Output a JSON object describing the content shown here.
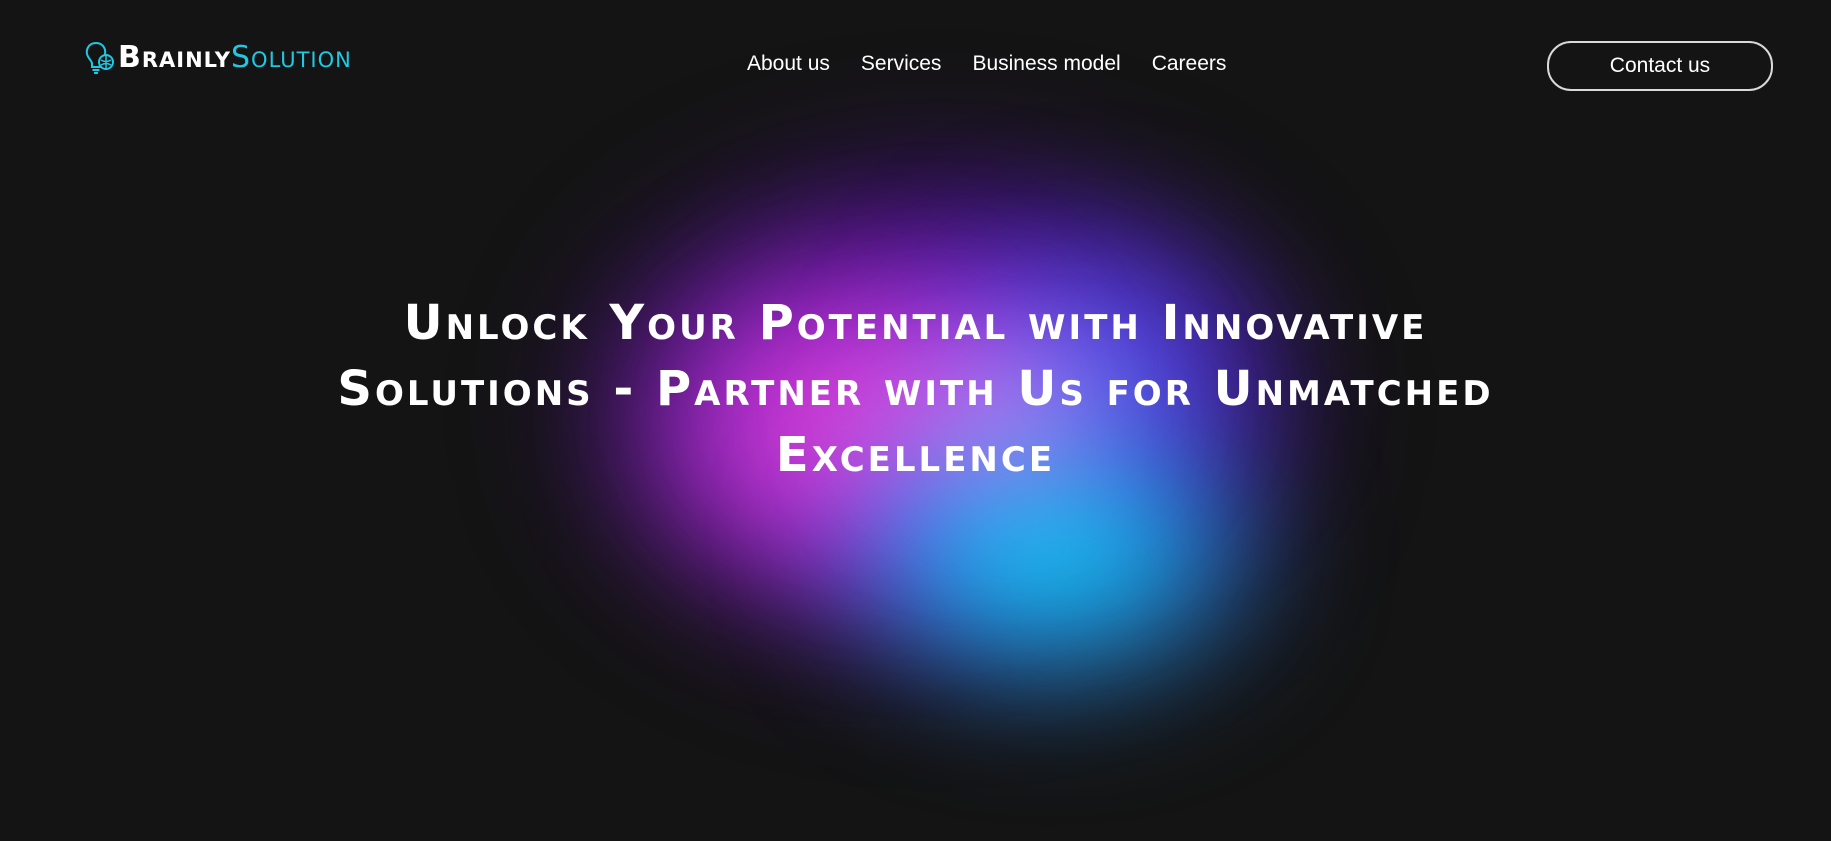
{
  "brand": {
    "name_part_1": "Brainly",
    "name_part_2": "Solution",
    "icon": "lightbulb-brain-icon",
    "colors": {
      "primary_text": "#ffffff",
      "accent": "#1fc8e3"
    }
  },
  "nav": {
    "items": [
      {
        "label": "About us"
      },
      {
        "label": "Services"
      },
      {
        "label": "Business model"
      },
      {
        "label": "Careers"
      }
    ]
  },
  "header": {
    "contact_label": "Contact us"
  },
  "hero": {
    "title": "Unlock Your Potential with Innovative Solutions - Partner with Us for Unmatched Excellence",
    "glow_colors": [
      "#7614dc",
      "#ff50d2",
      "#00dcfa",
      "#3c6eff"
    ]
  },
  "theme": {
    "background": "#141414"
  }
}
